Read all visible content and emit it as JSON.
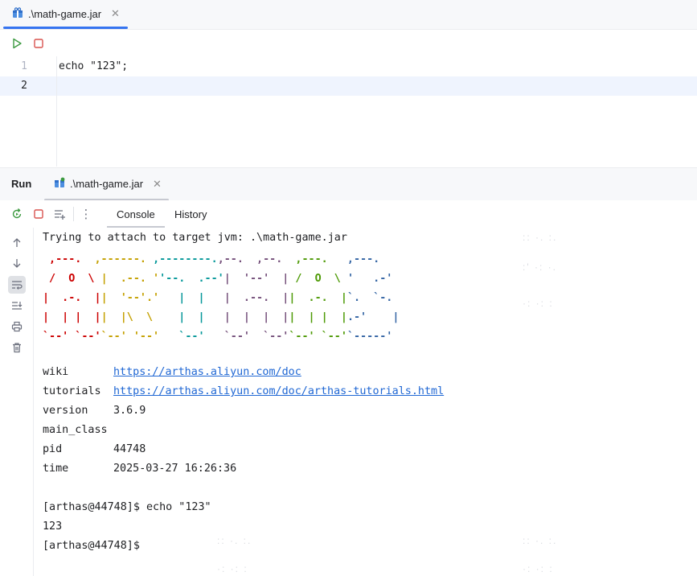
{
  "editor_tab": {
    "label": ".\\math-game.jar",
    "close": "✕"
  },
  "editor": {
    "lines": [
      "1",
      "2"
    ],
    "code": [
      "echo \"123\";",
      ""
    ]
  },
  "run_panel": {
    "title": "Run",
    "tab_label": ".\\math-game.jar",
    "tab_close": "✕",
    "console_tab": "Console",
    "history_tab": "History",
    "more_icon": "⋮"
  },
  "console": {
    "attach_line": "Trying to attach to target jvm: .\\math-game.jar",
    "logo": {
      "rows": [
        [
          " ,---. ",
          " ,------. ",
          ",--------.",
          ",--.  ,--. ",
          " ,---.  ",
          " ,---. "
        ],
        [
          " /  O  \\ ",
          "|  .--. '",
          "'--.  .--'",
          "|  '--'  |",
          " /  O  \\ ",
          "'   .-' "
        ],
        [
          "|  .-.  |",
          "|  '--'.'",
          "   |  |   ",
          "|  .--.  |",
          "|  .-.  |",
          "`.  `-. "
        ],
        [
          "|  | |  |",
          "|  |\\  \\ ",
          "   |  |   ",
          "|  |  |  |",
          "|  | |  |",
          ".-'    |"
        ],
        [
          "`--' `--'",
          "`--' '--'",
          "   `--'   ",
          "`--'  `--'",
          "`--' `--'",
          "`-----' "
        ]
      ],
      "colors": [
        "#cc0000",
        "#c4a000",
        "#06989a",
        "#75507b",
        "#4e9a06",
        "#3465a4"
      ]
    },
    "info": [
      {
        "key": "wiki",
        "value": "https://arthas.aliyun.com/doc",
        "link": true
      },
      {
        "key": "tutorials",
        "value": "https://arthas.aliyun.com/doc/arthas-tutorials.html",
        "link": true
      },
      {
        "key": "version",
        "value": "3.6.9",
        "link": false
      },
      {
        "key": "main_class",
        "value": "",
        "link": false
      },
      {
        "key": "pid",
        "value": "44748",
        "link": false
      },
      {
        "key": "time",
        "value": "2025-03-27 16:26:36",
        "link": false
      }
    ],
    "prompt_cmd": "[arthas@44748]$ echo \"123\"",
    "output": "123",
    "prompt": "[arthas@44748]$"
  },
  "colors": {
    "accent": "#3574f0",
    "run_green": "#3c9a40",
    "stop_red": "#d9534f"
  },
  "icons": {
    "tab": "package-icon",
    "run": "run-icon",
    "stop": "stop-icon",
    "rerun": "rerun-icon",
    "wrap": "soft-wrap-icon",
    "up": "arrow-up-icon",
    "down": "arrow-down-icon",
    "scroll": "scroll-to-end-icon",
    "print": "print-icon",
    "trash": "trash-icon"
  }
}
